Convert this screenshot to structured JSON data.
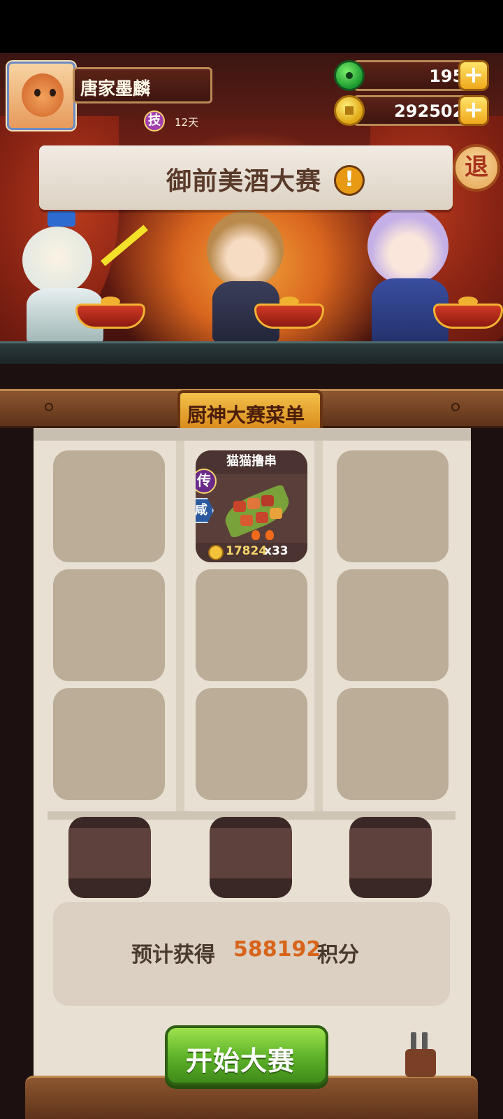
{
  "player": {
    "name": "唐家墨麟",
    "skill_badge": "技",
    "skill_days": "12天"
  },
  "resources": {
    "jade": "1959",
    "coins": "2925026",
    "plus_label": "+"
  },
  "exit_label": "退",
  "banner_title": "御前美酒大赛",
  "alert_label": "!",
  "menu": {
    "title": "厨神大赛菜单",
    "dish": {
      "name": "猫猫撸串",
      "rarity": "传",
      "flavor": "咸",
      "price": "17824",
      "count": "x33"
    }
  },
  "estimate": {
    "label": "预计获得",
    "value": "588192",
    "unit": "积分"
  },
  "start_button": "开始大赛",
  "colors": {
    "accent_orange": "#d8641c",
    "start_green": "#5cb028",
    "rail_brown": "#8c5630"
  }
}
